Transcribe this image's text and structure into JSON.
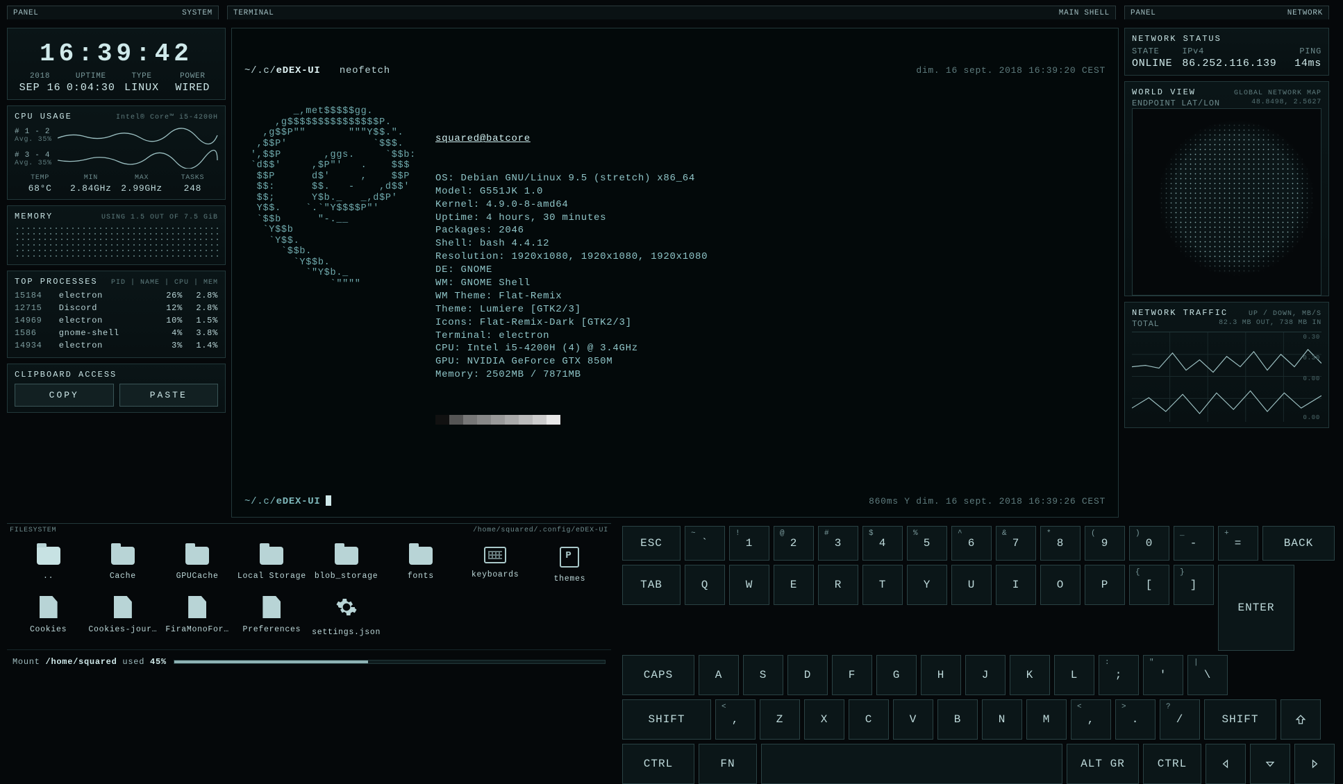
{
  "tabs": {
    "left_l": "PANEL",
    "left_r": "SYSTEM",
    "mid_l": "TERMINAL",
    "mid_r": "MAIN SHELL",
    "right_l": "PANEL",
    "right_r": "NETWORK"
  },
  "clock": "16:39:42",
  "date": {
    "year_l": "2018",
    "year_v": "SEP 16",
    "uptime_l": "UPTIME",
    "uptime_v": "0:04:30",
    "type_l": "TYPE",
    "type_v": "LINUX",
    "power_l": "POWER",
    "power_v": "WIRED"
  },
  "cpu": {
    "title": "CPU USAGE",
    "model": "Intel® Core™ i5-4200H",
    "g1_l": "# 1 - 2",
    "g1_a": "Avg. 35%",
    "g2_l": "# 3 - 4",
    "g2_a": "Avg. 35%",
    "temp_l": "TEMP",
    "temp_v": "68°C",
    "min_l": "MIN",
    "min_v": "2.84GHz",
    "max_l": "MAX",
    "max_v": "2.99GHz",
    "tasks_l": "TASKS",
    "tasks_v": "248"
  },
  "mem": {
    "title": "MEMORY",
    "sub": "USING 1.5 OUT OF 7.5 GiB"
  },
  "procs": {
    "title": "TOP PROCESSES",
    "cols": "PID | NAME | CPU | MEM",
    "rows": [
      {
        "pid": "15184",
        "name": "electron",
        "cpu": "26%",
        "mem": "2.8%"
      },
      {
        "pid": "12715",
        "name": "Discord",
        "cpu": "12%",
        "mem": "2.8%"
      },
      {
        "pid": "14969",
        "name": "electron",
        "cpu": "10%",
        "mem": "1.5%"
      },
      {
        "pid": "1586",
        "name": "gnome-shell",
        "cpu": "4%",
        "mem": "3.8%"
      },
      {
        "pid": "14934",
        "name": "electron",
        "cpu": "3%",
        "mem": "1.4%"
      }
    ]
  },
  "clip": {
    "title": "CLIPBOARD ACCESS",
    "copy": "COPY",
    "paste": "PASTE"
  },
  "terminal": {
    "prompt_pre": "~/.c/",
    "prompt_bold": "eDEX-UI",
    "cmd": "neofetch",
    "ts1": "dim. 16 sept. 2018 16:39:20 CEST",
    "host": "squared@batcore",
    "lines": [
      "OS: Debian GNU/Linux 9.5 (stretch) x86_64",
      "Model: G551JK 1.0",
      "Kernel: 4.9.0-8-amd64",
      "Uptime: 4 hours, 30 minutes",
      "Packages: 2046",
      "Shell: bash 4.4.12",
      "Resolution: 1920x1080, 1920x1080, 1920x1080",
      "DE: GNOME",
      "WM: GNOME Shell",
      "WM Theme: Flat-Remix",
      "Theme: Lumiere [GTK2/3]",
      "Icons: Flat-Remix-Dark [GTK2/3]",
      "Terminal: electron",
      "CPU: Intel i5-4200H (4) @ 3.4GHz",
      "GPU: NVIDIA GeForce GTX 850M",
      "Memory: 2502MB / 7871MB"
    ],
    "ascii": "        _,met$$$$$gg.\n     ,g$$$$$$$$$$$$$$$P.\n   ,g$$P\"\"       \"\"\"Y$$.\".\n  ,$$P'              `$$$.\n ',$$P       ,ggs.     `$$b:\n `d$$'     ,$P\"'   .    $$$\n  $$P      d$'     ,    $$P\n  $$:      $$.   -    ,d$$'\n  $$;      Y$b._   _,d$P'\n  Y$$.    `.`\"Y$$$$P\"'\n  `$$b      \"-.__\n   `Y$$b\n    `Y$$.\n      `$$b.\n        `Y$$b.\n          `\"Y$b._\n              `\"\"\"\"",
    "palette": [
      "#111",
      "#555",
      "#777",
      "#888",
      "#999",
      "#aaa",
      "#bbb",
      "#ccc",
      "#e8e8e8"
    ],
    "ts2": "860ms Y dim. 16 sept. 2018 16:39:26 CEST"
  },
  "net": {
    "title": "NETWORK STATUS",
    "state_l": "STATE",
    "state_v": "ONLINE",
    "ip_l": "IPv4",
    "ip_v": "86.252.116.139",
    "ping_l": "PING",
    "ping_v": "14ms",
    "world_t": "WORLD VIEW",
    "world_s": "GLOBAL NETWORK MAP",
    "endpoint_l": "ENDPOINT LAT/LON",
    "endpoint_v": "48.8498, 2.5627",
    "traffic_t": "NETWORK TRAFFIC",
    "traffic_s": "UP / DOWN, MB/S",
    "total_l": "TOTAL",
    "total_v": "82.3 MB OUT, 738 MB IN",
    "ticks": [
      "0.30",
      "0.30",
      "0.00",
      "0.00"
    ]
  },
  "fs": {
    "title": "FILESYSTEM",
    "path": "/home/squared/.config/eDEX-UI",
    "items": [
      {
        "type": "folder-cur",
        "label": ".."
      },
      {
        "type": "folder",
        "label": "Cache"
      },
      {
        "type": "folder",
        "label": "GPUCache"
      },
      {
        "type": "folder",
        "label": "Local Storage"
      },
      {
        "type": "folder",
        "label": "blob_storage"
      },
      {
        "type": "folder",
        "label": "fonts"
      },
      {
        "type": "kb",
        "label": "keyboards"
      },
      {
        "type": "theme",
        "label": "themes"
      },
      {
        "type": "file",
        "label": "Cookies"
      },
      {
        "type": "file",
        "label": "Cookies-jour…"
      },
      {
        "type": "file",
        "label": "FiraMonoFor…"
      },
      {
        "type": "file",
        "label": "Preferences"
      },
      {
        "type": "gear",
        "label": "settings.json"
      }
    ],
    "mount_pre": "Mount ",
    "mount_path": "/home/squared",
    "mount_used": " used ",
    "mount_pct": "45%"
  },
  "kb": {
    "esc": "ESC",
    "back": "BACK",
    "tab": "TAB",
    "enter": "ENTER",
    "caps": "CAPS",
    "shift": "SHIFT",
    "ctrl": "CTRL",
    "fn": "FN",
    "altgr": "ALT GR",
    "row1": [
      [
        "~",
        "`"
      ],
      [
        "!",
        "1"
      ],
      [
        "@",
        "2"
      ],
      [
        "#",
        "3"
      ],
      [
        "$",
        "4"
      ],
      [
        "%",
        "5"
      ],
      [
        "^",
        "6"
      ],
      [
        "&",
        "7"
      ],
      [
        "*",
        "8"
      ],
      [
        "(",
        "9"
      ],
      [
        ")",
        "0"
      ],
      [
        "_",
        "-"
      ],
      [
        "+",
        "="
      ]
    ],
    "row2": [
      "Q",
      "W",
      "E",
      "R",
      "T",
      "Y",
      "U",
      "I",
      "O",
      "P"
    ],
    "row2b": [
      [
        "{",
        "["
      ],
      [
        "}",
        "]"
      ]
    ],
    "row3": [
      "A",
      "S",
      "D",
      "F",
      "G",
      "H",
      "J",
      "K",
      "L"
    ],
    "row3b": [
      [
        ":",
        ";"
      ],
      [
        "\"",
        "'"
      ],
      [
        "|",
        "\\"
      ]
    ],
    "row4a": [
      "<",
      ","
    ],
    "row4": [
      "Z",
      "X",
      "C",
      "V",
      "B",
      "N",
      "M"
    ],
    "row4b": [
      [
        "<",
        ","
      ],
      [
        ">",
        "."
      ],
      [
        "?",
        "/"
      ]
    ]
  }
}
